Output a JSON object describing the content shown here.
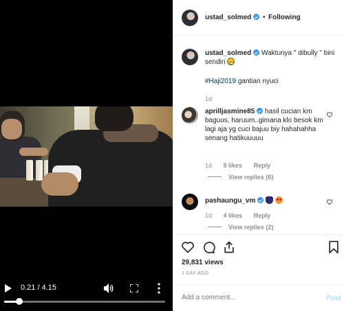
{
  "video": {
    "time": "0.21 / 4.15",
    "progress": 0.093,
    "icons": [
      "play-icon",
      "volume-icon",
      "fullscreen-icon",
      "more-vertical-icon"
    ]
  },
  "header": {
    "username": "ustad_solmed",
    "separator": "•",
    "follow_status": "Following"
  },
  "caption": {
    "username": "ustad_solmed",
    "text": "Waktunya \" dibully \" bini sendiri",
    "hashtag": "#Haji2019",
    "hashtag_rest": " gantian nyuci",
    "time": "1d"
  },
  "comments": [
    {
      "username": "aprilljasmine85",
      "text": "hasil cucian km baguus, haruum..gimana klo besok km lagi aja yg cuci bajuu biy hahahahha senang hatikuuuuu",
      "time": "1d",
      "likes": "9 likes",
      "reply": "Reply",
      "view_replies": "View replies (6)"
    },
    {
      "username": "pashaungu_vm",
      "text": "",
      "time": "1d",
      "likes": "4 likes",
      "reply": "Reply",
      "view_replies": "View replies (2)"
    }
  ],
  "stats": {
    "views": "29,831 views",
    "date": "1 DAY AGO"
  },
  "comment_box": {
    "placeholder": "Add a comment...",
    "post_label": "Post"
  },
  "colors": {
    "verified": "#3897f0",
    "hashtag": "#003569",
    "post_disabled": "#b2dffc",
    "muted": "#8e8e8e"
  }
}
